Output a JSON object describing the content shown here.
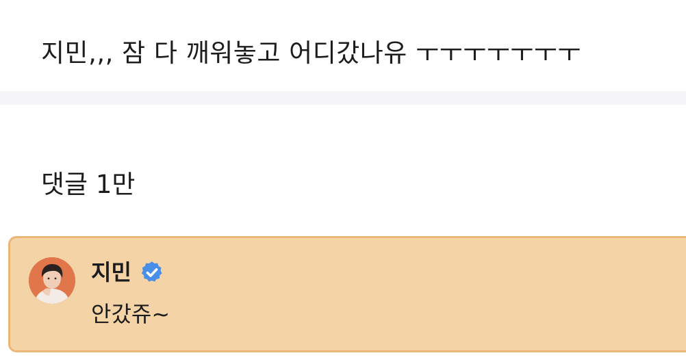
{
  "post": {
    "text": "지민,,, 잠 다 깨워놓고 어디갔나유 ㅜㅜㅜㅜㅜㅜㅜ"
  },
  "comments_section": {
    "header": "댓글 1만"
  },
  "pinned_comment": {
    "author": "지민",
    "verified_icon": "verified-check-icon",
    "text": "안갔쥬~",
    "colors": {
      "card_background": "#f4d4a7",
      "card_border": "#ebb777",
      "verified_badge": "#4a8fe7"
    }
  }
}
